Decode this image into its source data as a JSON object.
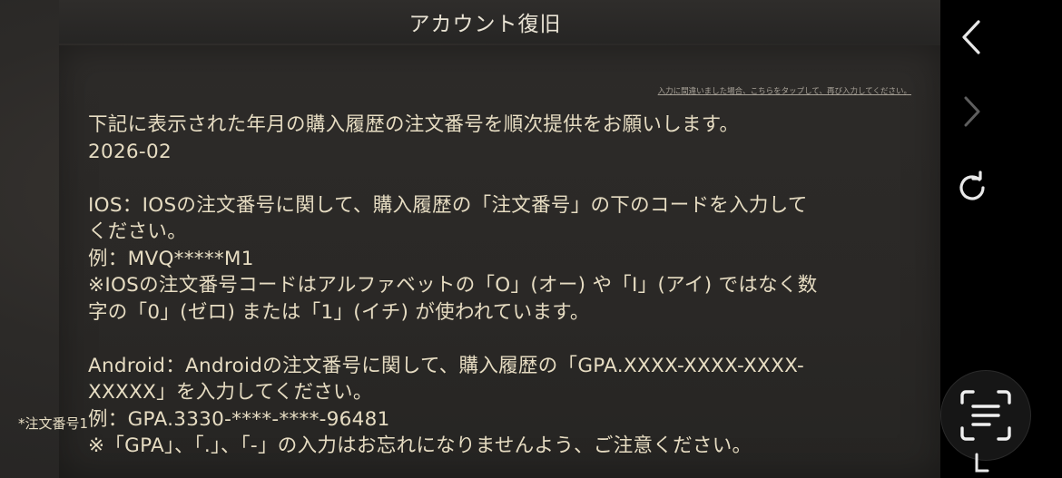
{
  "header": {
    "title": "アカウント復旧"
  },
  "panel": {
    "retry_link": "入力に間違いました場合、こちらをタップして、再び入力してください。",
    "lines": [
      "下記に表示された年月の購入履歴の注文番号を順次提供をお願いします。",
      "2026-02",
      "",
      "IOS：IOSの注文番号に関して、購入履歴の「注文番号」の下のコードを入力して",
      "ください。",
      "例：MVQ*****M1",
      "※IOSの注文番号コードはアルファベットの「O」(オー) や「I」(アイ) ではなく数",
      "字の「0」(ゼロ) または「1」(イチ) が使われています。",
      "",
      "Android：Androidの注文番号に関して、購入履歴の「GPA.XXXX-XXXX-XXXX-",
      "XXXXX」を入力してください。",
      "例：GPA.3330-****-****-96481",
      "※「GPA」、「.」、「-」の入力はお忘れになりませんよう、ご注意ください。"
    ],
    "field_label": "*注文番号1"
  },
  "sidebar": {
    "icons": [
      "chevron-left-icon",
      "chevron-right-icon",
      "reload-icon",
      "text-scan-icon"
    ]
  },
  "colors": {
    "text": "#e6dcc2",
    "background": "#2b2927",
    "sidebar": "#000000"
  }
}
